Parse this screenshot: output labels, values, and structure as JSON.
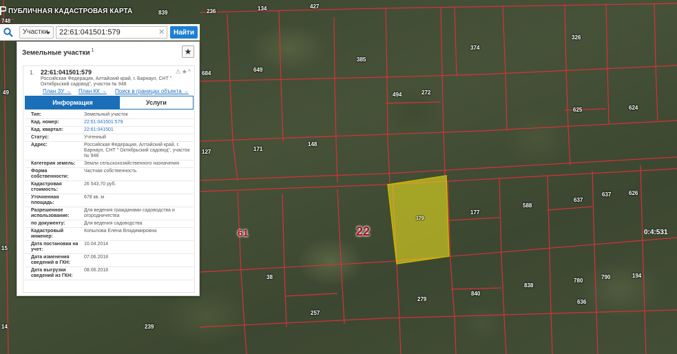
{
  "app": {
    "title": "ПУБЛИЧНАЯ КАДАСТРОВАЯ КАРТА"
  },
  "search": {
    "type_label": "Участки",
    "value": "22:61:041501:579",
    "find_label": "Найти"
  },
  "panel": {
    "title": "Земельные участки",
    "count": "1",
    "item": {
      "num": "1.",
      "cad_number": "22:61:041501:579",
      "address": "Российская Федерация, Алтайский край, г. Барнаул, СНТ \" Октябрьский садовод\", участок № 948",
      "links": {
        "plan_zu": "План ЗУ →",
        "plan_kk": "План КК →",
        "search_in_bounds": "Поиск в границах объекта →"
      }
    },
    "tabs": {
      "info": "Информация",
      "services": "Услуги"
    },
    "props": [
      {
        "key": "Тип:",
        "value": "Земельный участок"
      },
      {
        "key": "Кад. номер:",
        "value": "22:61:041501:579"
      },
      {
        "key": "Кад. квартал:",
        "value": "22:61:041501"
      },
      {
        "key": "Статус:",
        "value": "Учтенный"
      },
      {
        "key": "Адрес:",
        "value": "Российская Федерация, Алтайский край, г. Барнаул, СНТ \" Октябрьский садовод\", участок № 948"
      },
      {
        "key": "Категория земель:",
        "value": "Земли сельскохозяйственного назначения"
      },
      {
        "key": "Форма собственности:",
        "value": "Частная собственность"
      },
      {
        "key": "Кадастровая стоимость:",
        "value": "26 543,70 руб."
      },
      {
        "key": "Уточненная площадь:",
        "value": "678 кв. м"
      },
      {
        "key": "Разрешенное использование:",
        "value": "Для ведения гражданами садоводства и огородничества"
      },
      {
        "key": "по документу:",
        "value": "Для ведения садоводства"
      },
      {
        "key": "Кадастровый инженер:",
        "value": "Копылова Елена Владимировна"
      },
      {
        "key": "Дата постановки на учет:",
        "value": "10.04.2014"
      },
      {
        "key": "Дата изменения сведений в ГКН:",
        "value": "07.06.2018"
      },
      {
        "key": "Дата выгрузки сведений из ГКН:",
        "value": "08.06.2018"
      }
    ]
  },
  "map": {
    "plot_labels": [
      "839",
      "236",
      "134",
      "427",
      "748",
      "326",
      "385",
      "374",
      "649",
      "684",
      "494",
      "272",
      "625",
      "624",
      "171",
      "148",
      "177",
      "127",
      "179",
      "588",
      "637",
      "637",
      "626",
      "838",
      "780",
      "790",
      "194",
      "279",
      "840",
      "636",
      "257",
      "38",
      "239",
      "49",
      "15",
      "14"
    ],
    "quarter_label": "22",
    "quarter_label_2": "61",
    "block_label": "0:4:531",
    "colors": {
      "boundary": "#e0303a",
      "selected_fill": "#e8e020",
      "selected_stroke": "#c8b800"
    }
  }
}
